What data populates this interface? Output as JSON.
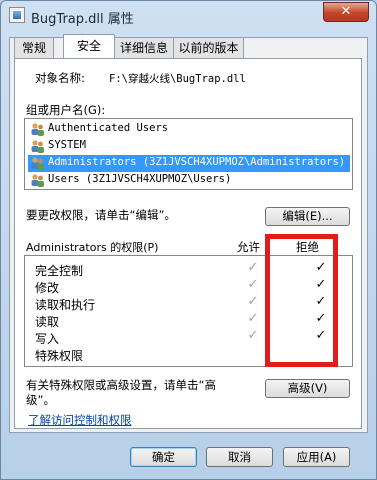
{
  "window": {
    "title": "BugTrap.dll 属性",
    "close_label": "✕"
  },
  "tabs": [
    {
      "label": "常规"
    },
    {
      "label": "安全"
    },
    {
      "label": "详细信息"
    },
    {
      "label": "以前的版本"
    }
  ],
  "security": {
    "object_label": "对象名称:",
    "object_value": "F:\\穿越火线\\BugTrap.dll",
    "groups_label": "组或用户名(G):",
    "groups": [
      {
        "name": "Authenticated Users",
        "icon": "users-icon",
        "selected": false
      },
      {
        "name": "SYSTEM",
        "icon": "users-icon",
        "selected": false
      },
      {
        "name": "Administrators (3Z1JVSCH4XUPMOZ\\Administrators)",
        "icon": "users-icon",
        "selected": true
      },
      {
        "name": "Users (3Z1JVSCH4XUPMOZ\\Users)",
        "icon": "users-icon",
        "selected": false
      }
    ],
    "change_hint": "要更改权限，请单击“编辑”。",
    "edit_button": "编辑(E)...",
    "perm_header": "Administrators 的权限(P)",
    "allow_header": "允许",
    "deny_header": "拒绝",
    "permissions": [
      {
        "name": "完全控制",
        "allow": "✓",
        "deny": "✓"
      },
      {
        "name": "修改",
        "allow": "✓",
        "deny": "✓"
      },
      {
        "name": "读取和执行",
        "allow": "✓",
        "deny": "✓"
      },
      {
        "name": "读取",
        "allow": "✓",
        "deny": "✓"
      },
      {
        "name": "写入",
        "allow": "✓",
        "deny": "✓"
      },
      {
        "name": "特殊权限",
        "allow": "",
        "deny": ""
      }
    ],
    "advanced_hint_line1": "有关特殊权限或高级设置，请单击“高",
    "advanced_hint_line2": "级”。",
    "advanced_button": "高级(V)",
    "learn_link": "了解访问控制和权限"
  },
  "footer": {
    "ok": "确定",
    "cancel": "取消",
    "apply": "应用(A)"
  },
  "colors": {
    "highlight_box": "#e31b1b",
    "selection": "#3399ff",
    "link": "#0645ad"
  }
}
